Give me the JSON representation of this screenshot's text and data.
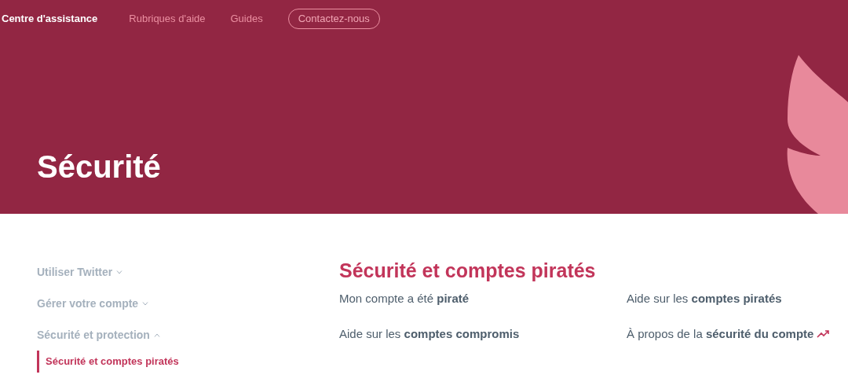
{
  "nav": {
    "brand": "Centre d'assistance",
    "links": [
      {
        "label": "Rubriques d'aide",
        "kind": "link"
      },
      {
        "label": "Guides",
        "kind": "link"
      },
      {
        "label": "Contactez-nous",
        "kind": "button"
      }
    ]
  },
  "hero": {
    "title": "Sécurité"
  },
  "sidebar": {
    "items": [
      {
        "label": "Utiliser Twitter",
        "expanded": false
      },
      {
        "label": "Gérer votre compte",
        "expanded": false
      },
      {
        "label": "Sécurité et protection",
        "expanded": true,
        "children": [
          {
            "label": "Sécurité et comptes piratés",
            "selected": true
          }
        ]
      }
    ]
  },
  "section": {
    "title": "Sécurité et comptes piratés",
    "links": [
      {
        "text": "Mon compte a été **piraté**",
        "kind": "plain"
      },
      {
        "text": "Aide sur les **comptes piratés**",
        "kind": "plain"
      },
      {
        "text": "Aide sur les **comptes compromis**",
        "kind": "plain"
      },
      {
        "text": "À propos de la **sécurité du compte**",
        "kind": "trending"
      }
    ]
  }
}
